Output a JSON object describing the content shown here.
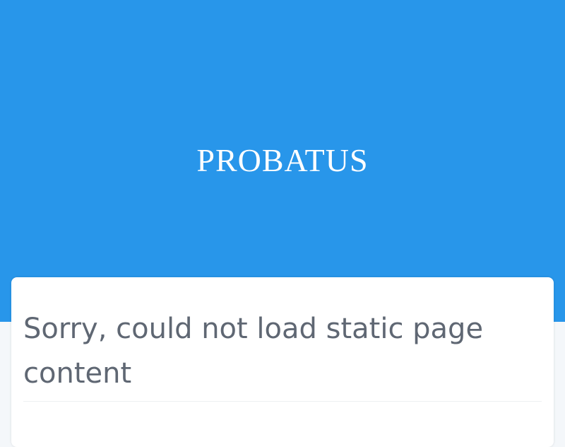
{
  "header": {
    "brand": "PROBATUS",
    "background_color": "#2896ea"
  },
  "content": {
    "message": "Sorry, could not load static page content"
  }
}
